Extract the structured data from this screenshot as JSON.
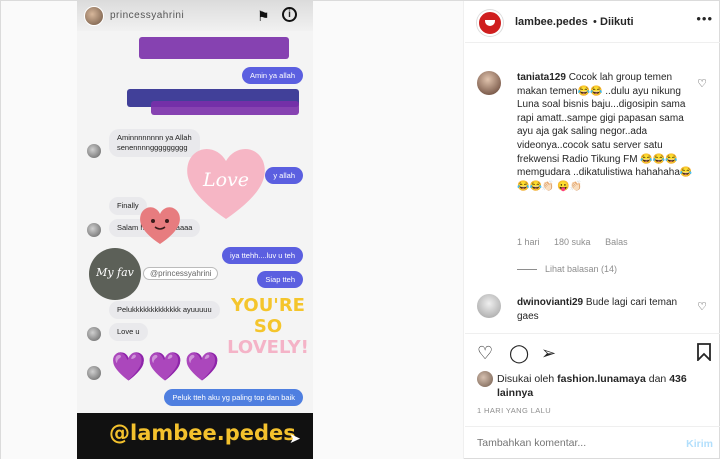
{
  "story": {
    "username": "princessyahrini",
    "messages": {
      "amin": "Amin ya allah",
      "aminnn": "Aminnnnnnnn ya Allah\nsenennnnggggggggg",
      "partial_right": "y allah",
      "finally": "Finally",
      "salam": "Salam                h ibu iqis yaaaa",
      "iya": "iya ttehh....luv u teh",
      "siap": "Siap tteh",
      "peluk": "Pelukkkkkkkkkkkkk ayuuuuu",
      "loveu": "Love u",
      "last": "Peluk tteh aku yg paling top dan baik"
    },
    "stickers": {
      "love_heart": "Love",
      "circle": "My fav",
      "handle": "@princessyahrini",
      "lovely_line1": "YOU'RE",
      "lovely_line2": "SO",
      "lovely_line3": "LOVELY!",
      "purple_hearts": "💜💜💜"
    },
    "bottom_handle": "@lambee.pedes"
  },
  "header": {
    "username": "lambee.pedes",
    "dot": "•",
    "follow_status": "Diikuti",
    "more": "•••"
  },
  "comments": [
    {
      "username": "taniata129",
      "text": "Cocok lah group temen makan temen😂😂 ..dulu ayu nikung Luna soal bisnis baju...digosipin sama rapi amatt..sampe gigi papasan sama ayu aja gak saling negor..ada videonya..cocok satu server satu frekwensi Radio Tikung FM 😂😂😂memgudara ..dikatulistiwa hahahaha😂😂😂👏🏻 😛👏🏻",
      "time": "1 hari",
      "likes": "180 suka",
      "reply": "Balas",
      "view_replies": "Lihat balasan (14)"
    },
    {
      "username": "dwinovianti29",
      "text": "Bude lagi cari teman gaes"
    }
  ],
  "likes": {
    "prefix": "Disukai oleh",
    "user": "fashion.lunamaya",
    "middle": "dan",
    "count": "436 lainnya"
  },
  "timestamp": "1 HARI YANG LALU",
  "add_comment": {
    "placeholder": "Tambahkan komentar...",
    "post": "Kirim"
  }
}
